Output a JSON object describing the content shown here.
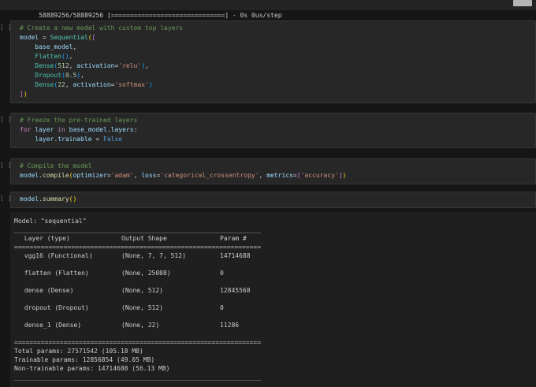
{
  "colors": {
    "page_bg": "#161616",
    "cell_bg": "#272728",
    "output_bg": "#1f1f1f",
    "comment": "#6a9955",
    "string": "#ce9178",
    "number": "#b5cea8",
    "keyword": "#c586c0",
    "constant": "#569cd6",
    "class_name": "#4ec9b0",
    "function_name": "#dcdcaa",
    "variable": "#9cdcfe",
    "plain_text": "#d4d4d4",
    "output_text": "#cccccc"
  },
  "progress": {
    "text": "58889256/58889256 [==============================] - 0s 0us/step"
  },
  "cells": [
    {
      "execution": "[ ]",
      "lines": [
        [
          [
            "c",
            "# Create a new model with custom top layers"
          ]
        ],
        [
          [
            "v",
            "model"
          ],
          [
            "p",
            " = "
          ],
          [
            "cl",
            "Sequential"
          ],
          [
            "b1",
            "("
          ],
          [
            "b2",
            "["
          ]
        ],
        [
          [
            "p",
            "    "
          ],
          [
            "v",
            "base_model"
          ],
          [
            "p",
            ","
          ]
        ],
        [
          [
            "p",
            "    "
          ],
          [
            "cl",
            "Flatten"
          ],
          [
            "b3",
            "()"
          ],
          [
            "p",
            ","
          ]
        ],
        [
          [
            "p",
            "    "
          ],
          [
            "cl",
            "Dense"
          ],
          [
            "b3",
            "("
          ],
          [
            "n",
            "512"
          ],
          [
            "p",
            ", "
          ],
          [
            "v",
            "activation"
          ],
          [
            "p",
            "="
          ],
          [
            "s",
            "'relu'"
          ],
          [
            "b3",
            ")"
          ],
          [
            "p",
            ","
          ]
        ],
        [
          [
            "p",
            "    "
          ],
          [
            "cl",
            "Dropout"
          ],
          [
            "b3",
            "("
          ],
          [
            "n",
            "0.5"
          ],
          [
            "b3",
            ")"
          ],
          [
            "p",
            ","
          ]
        ],
        [
          [
            "p",
            "    "
          ],
          [
            "cl",
            "Dense"
          ],
          [
            "b3",
            "("
          ],
          [
            "n",
            "22"
          ],
          [
            "p",
            ", "
          ],
          [
            "v",
            "activation"
          ],
          [
            "p",
            "="
          ],
          [
            "s",
            "'softmax'"
          ],
          [
            "b3",
            ")"
          ]
        ],
        [
          [
            "b2",
            "]"
          ],
          [
            "b1",
            ")"
          ]
        ]
      ]
    },
    {
      "execution": "[ ]",
      "lines": [
        [
          [
            "c",
            "# Freeze the pre-trained layers"
          ]
        ],
        [
          [
            "k",
            "for"
          ],
          [
            "p",
            " "
          ],
          [
            "v",
            "layer"
          ],
          [
            "p",
            " "
          ],
          [
            "k",
            "in"
          ],
          [
            "p",
            " "
          ],
          [
            "v",
            "base_model"
          ],
          [
            "p",
            "."
          ],
          [
            "v",
            "layers"
          ],
          [
            "p",
            ":"
          ]
        ],
        [
          [
            "p",
            "    "
          ],
          [
            "v",
            "layer"
          ],
          [
            "p",
            "."
          ],
          [
            "v",
            "trainable"
          ],
          [
            "p",
            " = "
          ],
          [
            "kc",
            "False"
          ]
        ]
      ]
    },
    {
      "execution": "[ ]",
      "lines": [
        [
          [
            "c",
            "# Compile the model"
          ]
        ],
        [
          [
            "v",
            "model"
          ],
          [
            "p",
            "."
          ],
          [
            "f",
            "compile"
          ],
          [
            "b1",
            "("
          ],
          [
            "v",
            "optimizer"
          ],
          [
            "p",
            "="
          ],
          [
            "s",
            "'adam'"
          ],
          [
            "p",
            ", "
          ],
          [
            "v",
            "loss"
          ],
          [
            "p",
            "="
          ],
          [
            "s",
            "'categorical_crossentropy'"
          ],
          [
            "p",
            ", "
          ],
          [
            "v",
            "metrics"
          ],
          [
            "p",
            "="
          ],
          [
            "b2",
            "["
          ],
          [
            "s",
            "'accuracy'"
          ],
          [
            "b2",
            "]"
          ],
          [
            "b1",
            ")"
          ]
        ]
      ]
    },
    {
      "execution": "[ ]",
      "lines": [
        [
          [
            "v",
            "model"
          ],
          [
            "p",
            "."
          ],
          [
            "f",
            "summary"
          ],
          [
            "b1",
            "()"
          ]
        ]
      ]
    }
  ],
  "summary": {
    "model_line": "Model: \"sequential\"",
    "line_underscore": "_________________________________________________________________",
    "line_equals": "=================================================================",
    "headers": [
      " Layer (type)",
      "Output Shape",
      "Param #"
    ],
    "rows": [
      [
        " vgg16 (Functional)",
        "(None, 7, 7, 512)",
        "14714688"
      ],
      [
        " flatten (Flatten)",
        "(None, 25088)",
        "0"
      ],
      [
        " dense (Dense)",
        "(None, 512)",
        "12845568"
      ],
      [
        " dropout (Dropout)",
        "(None, 512)",
        "0"
      ],
      [
        " dense_1 (Dense)",
        "(None, 22)",
        "11286"
      ]
    ],
    "totals": [
      "Total params: 27571542 (105.18 MB)",
      "Trainable params: 12856854 (49.05 MB)",
      "Non-trainable params: 14714688 (56.13 MB)"
    ]
  }
}
